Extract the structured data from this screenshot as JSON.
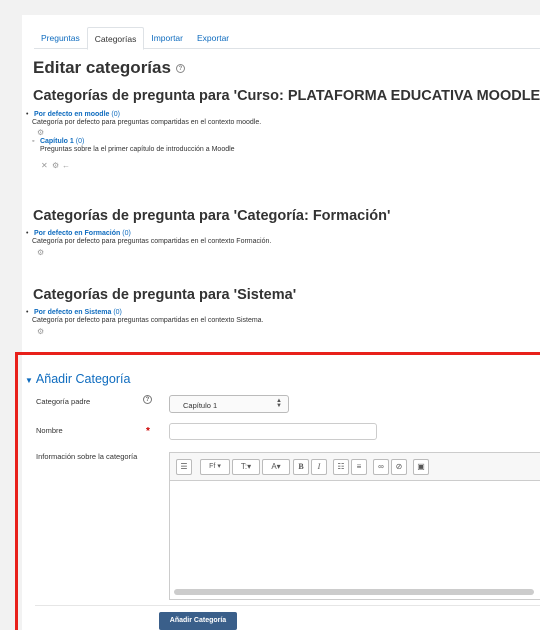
{
  "tabs": [
    "Preguntas",
    "Categorías",
    "Importar",
    "Exportar"
  ],
  "page_title": "Editar categorías",
  "sections": [
    {
      "heading": "Categorías de pregunta para 'Curso: PLATAFORMA EDUCATIVA MOODLE'",
      "items": [
        {
          "name": "Por defecto en moodle",
          "count": "(0)",
          "desc": "Categoría por defecto para preguntas compartidas en el contexto moodle."
        },
        {
          "name": "Capítulo 1",
          "count": "(0)",
          "desc": "Preguntas sobre la el primer capítulo de introducción a Moodle"
        }
      ]
    },
    {
      "heading": "Categorías de pregunta para 'Categoría: Formación'",
      "items": [
        {
          "name": "Por defecto en Formación",
          "count": "(0)",
          "desc": "Categoría por defecto para preguntas compartidas en el contexto Formación."
        }
      ]
    },
    {
      "heading": "Categorías de pregunta para 'Sistema'",
      "items": [
        {
          "name": "Por defecto en Sistema",
          "count": "(0)",
          "desc": "Categoría por defecto para preguntas compartidas en el contexto Sistema."
        }
      ]
    }
  ],
  "form": {
    "legend": "Añadir Categoría",
    "parent_label": "Categoría padre",
    "parent_value": "Capítulo 1",
    "name_label": "Nombre",
    "info_label": "Información sobre la categoría",
    "submit_label": "Añadir Categoría",
    "toolbar": {
      "font": "Ff",
      "size": "T:",
      "color": "A"
    }
  },
  "colors": {
    "link": "#0f6cbf",
    "highlight": "#e8201a",
    "button": "#3a5f8a"
  }
}
